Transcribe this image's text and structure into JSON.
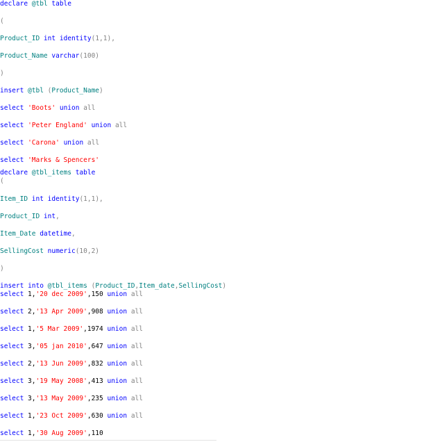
{
  "colors": {
    "keyword": "#0000ff",
    "identifier": "#008080",
    "string": "#ff0000",
    "gray": "#808080",
    "plain": "#000000",
    "background": "#ffffff"
  },
  "code_lines": [
    {
      "tokens": [
        {
          "t": "declare",
          "c": "kw"
        },
        {
          "t": " @tbl ",
          "c": "ident"
        },
        {
          "t": "table",
          "c": "kw"
        }
      ]
    },
    {
      "tokens": [
        {
          "t": "(",
          "c": "gray"
        }
      ]
    },
    {
      "tokens": [
        {
          "t": "Product_ID ",
          "c": "ident"
        },
        {
          "t": "int",
          "c": "kw"
        },
        {
          "t": " ",
          "c": "plain"
        },
        {
          "t": "identity",
          "c": "kw"
        },
        {
          "t": "(1,1),",
          "c": "gray"
        }
      ]
    },
    {
      "tokens": [
        {
          "t": "Product_Name ",
          "c": "ident"
        },
        {
          "t": "varchar",
          "c": "kw"
        },
        {
          "t": "(100)",
          "c": "gray"
        }
      ]
    },
    {
      "tokens": [
        {
          "t": ")",
          "c": "gray"
        }
      ]
    },
    {
      "tokens": [
        {
          "t": "insert",
          "c": "kw"
        },
        {
          "t": " @tbl ",
          "c": "ident"
        },
        {
          "t": "(",
          "c": "gray"
        },
        {
          "t": "Product_Name",
          "c": "ident"
        },
        {
          "t": ")",
          "c": "gray"
        }
      ]
    },
    {
      "tokens": [
        {
          "t": "select",
          "c": "kw"
        },
        {
          "t": " ",
          "c": "plain"
        },
        {
          "t": "'Boots'",
          "c": "str"
        },
        {
          "t": " ",
          "c": "plain"
        },
        {
          "t": "union",
          "c": "kw"
        },
        {
          "t": " ",
          "c": "plain"
        },
        {
          "t": "all",
          "c": "gray"
        }
      ]
    },
    {
      "tokens": [
        {
          "t": "select",
          "c": "kw"
        },
        {
          "t": " ",
          "c": "plain"
        },
        {
          "t": "'Peter England'",
          "c": "str"
        },
        {
          "t": " ",
          "c": "plain"
        },
        {
          "t": "union",
          "c": "kw"
        },
        {
          "t": " ",
          "c": "plain"
        },
        {
          "t": "all",
          "c": "gray"
        }
      ]
    },
    {
      "tokens": [
        {
          "t": "select",
          "c": "kw"
        },
        {
          "t": " ",
          "c": "plain"
        },
        {
          "t": "'Carona'",
          "c": "str"
        },
        {
          "t": " ",
          "c": "plain"
        },
        {
          "t": "union",
          "c": "kw"
        },
        {
          "t": " ",
          "c": "plain"
        },
        {
          "t": "all",
          "c": "gray"
        }
      ]
    },
    {
      "tokens": [
        {
          "t": "select",
          "c": "kw"
        },
        {
          "t": " ",
          "c": "plain"
        },
        {
          "t": "'Marks & Spencers'",
          "c": "str"
        }
      ]
    },
    {
      "tokens": [
        {
          "t": "declare",
          "c": "kw"
        },
        {
          "t": " @tbl_items ",
          "c": "ident"
        },
        {
          "t": "table",
          "c": "kw"
        }
      ]
    },
    {
      "tokens": [
        {
          "t": "(",
          "c": "gray"
        }
      ]
    },
    {
      "tokens": [
        {
          "t": "Item_ID ",
          "c": "ident"
        },
        {
          "t": "int",
          "c": "kw"
        },
        {
          "t": " ",
          "c": "plain"
        },
        {
          "t": "identity",
          "c": "kw"
        },
        {
          "t": "(1,1),",
          "c": "gray"
        }
      ]
    },
    {
      "tokens": [
        {
          "t": "Product_ID ",
          "c": "ident"
        },
        {
          "t": "int",
          "c": "kw"
        },
        {
          "t": ",",
          "c": "gray"
        }
      ]
    },
    {
      "tokens": [
        {
          "t": "Item_Date ",
          "c": "ident"
        },
        {
          "t": "datetime",
          "c": "kw"
        },
        {
          "t": ",",
          "c": "gray"
        }
      ]
    },
    {
      "tokens": [
        {
          "t": "SellingCost ",
          "c": "ident"
        },
        {
          "t": "numeric",
          "c": "kw"
        },
        {
          "t": "(10,2)",
          "c": "gray"
        }
      ]
    },
    {
      "tokens": [
        {
          "t": ")",
          "c": "gray"
        }
      ]
    },
    {
      "tokens": [
        {
          "t": "insert",
          "c": "kw"
        },
        {
          "t": " ",
          "c": "plain"
        },
        {
          "t": "into",
          "c": "kw"
        },
        {
          "t": " @tbl_items ",
          "c": "ident"
        },
        {
          "t": "(",
          "c": "gray"
        },
        {
          "t": "Product_ID",
          "c": "ident"
        },
        {
          "t": ",",
          "c": "gray"
        },
        {
          "t": "Item_date",
          "c": "ident"
        },
        {
          "t": ",",
          "c": "gray"
        },
        {
          "t": "SellingCost",
          "c": "ident"
        },
        {
          "t": ")",
          "c": "gray"
        }
      ]
    },
    {
      "tokens": [
        {
          "t": "select",
          "c": "kw"
        },
        {
          "t": " 1,",
          "c": "plain"
        },
        {
          "t": "'20 dec 2009'",
          "c": "str"
        },
        {
          "t": ",150 ",
          "c": "plain"
        },
        {
          "t": "union",
          "c": "kw"
        },
        {
          "t": " ",
          "c": "plain"
        },
        {
          "t": "all",
          "c": "gray"
        }
      ]
    },
    {
      "tokens": [
        {
          "t": "select",
          "c": "kw"
        },
        {
          "t": " 2,",
          "c": "plain"
        },
        {
          "t": "'13 Apr 2009'",
          "c": "str"
        },
        {
          "t": ",908 ",
          "c": "plain"
        },
        {
          "t": "union",
          "c": "kw"
        },
        {
          "t": " ",
          "c": "plain"
        },
        {
          "t": "all",
          "c": "gray"
        }
      ]
    },
    {
      "tokens": [
        {
          "t": "select",
          "c": "kw"
        },
        {
          "t": " 1,",
          "c": "plain"
        },
        {
          "t": "'5 Mar 2009'",
          "c": "str"
        },
        {
          "t": ",1974 ",
          "c": "plain"
        },
        {
          "t": "union",
          "c": "kw"
        },
        {
          "t": " ",
          "c": "plain"
        },
        {
          "t": "all",
          "c": "gray"
        }
      ]
    },
    {
      "tokens": [
        {
          "t": "select",
          "c": "kw"
        },
        {
          "t": " 3,",
          "c": "plain"
        },
        {
          "t": "'05 jan 2010'",
          "c": "str"
        },
        {
          "t": ",647 ",
          "c": "plain"
        },
        {
          "t": "union",
          "c": "kw"
        },
        {
          "t": " ",
          "c": "plain"
        },
        {
          "t": "all",
          "c": "gray"
        }
      ]
    },
    {
      "tokens": [
        {
          "t": "select",
          "c": "kw"
        },
        {
          "t": " 2,",
          "c": "plain"
        },
        {
          "t": "'13 Jun 2009'",
          "c": "str"
        },
        {
          "t": ",832 ",
          "c": "plain"
        },
        {
          "t": "union",
          "c": "kw"
        },
        {
          "t": " ",
          "c": "plain"
        },
        {
          "t": "all",
          "c": "gray"
        }
      ]
    },
    {
      "tokens": [
        {
          "t": "select",
          "c": "kw"
        },
        {
          "t": " 3,",
          "c": "plain"
        },
        {
          "t": "'19 May 2008'",
          "c": "str"
        },
        {
          "t": ",413 ",
          "c": "plain"
        },
        {
          "t": "union",
          "c": "kw"
        },
        {
          "t": " ",
          "c": "plain"
        },
        {
          "t": "all",
          "c": "gray"
        }
      ]
    },
    {
      "tokens": [
        {
          "t": "select",
          "c": "kw"
        },
        {
          "t": " 3,",
          "c": "plain"
        },
        {
          "t": "'13 May 2009'",
          "c": "str"
        },
        {
          "t": ",235 ",
          "c": "plain"
        },
        {
          "t": "union",
          "c": "kw"
        },
        {
          "t": " ",
          "c": "plain"
        },
        {
          "t": "all",
          "c": "gray"
        }
      ]
    },
    {
      "tokens": [
        {
          "t": "select",
          "c": "kw"
        },
        {
          "t": " 1,",
          "c": "plain"
        },
        {
          "t": "'23 Oct 2009'",
          "c": "str"
        },
        {
          "t": ",630 ",
          "c": "plain"
        },
        {
          "t": "union",
          "c": "kw"
        },
        {
          "t": " ",
          "c": "plain"
        },
        {
          "t": "all",
          "c": "gray"
        }
      ]
    },
    {
      "tokens": [
        {
          "t": "select",
          "c": "kw"
        },
        {
          "t": " 1,",
          "c": "plain"
        },
        {
          "t": "'30 Aug 2009'",
          "c": "str"
        },
        {
          "t": ",110",
          "c": "plain"
        }
      ]
    }
  ]
}
